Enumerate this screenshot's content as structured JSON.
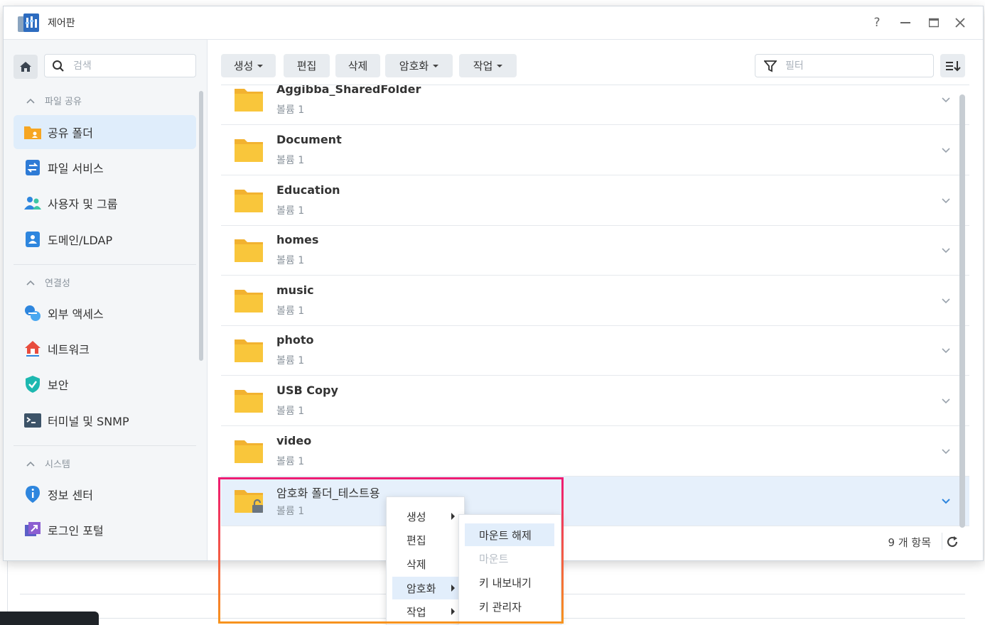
{
  "window": {
    "title": "제어판"
  },
  "titlebar": {
    "help": "?",
    "minimize": "—",
    "maximize": "▭",
    "close": "✕"
  },
  "sidebar": {
    "search_placeholder": "검색",
    "sections": [
      {
        "label": "파일 공유",
        "items": [
          {
            "label": "공유 폴더",
            "icon": "shared-folder-icon",
            "active": true
          },
          {
            "label": "파일 서비스",
            "icon": "file-services-icon"
          },
          {
            "label": "사용자 및 그룹",
            "icon": "user-group-icon"
          },
          {
            "label": "도메인/LDAP",
            "icon": "domain-ldap-icon"
          }
        ]
      },
      {
        "label": "연결성",
        "items": [
          {
            "label": "외부 액세스",
            "icon": "external-access-icon"
          },
          {
            "label": "네트워크",
            "icon": "network-icon"
          },
          {
            "label": "보안",
            "icon": "security-icon"
          },
          {
            "label": "터미널 및 SNMP",
            "icon": "terminal-icon"
          }
        ]
      },
      {
        "label": "시스템",
        "items": [
          {
            "label": "정보 센터",
            "icon": "info-center-icon"
          },
          {
            "label": "로그인 포털",
            "icon": "login-portal-icon"
          }
        ]
      }
    ]
  },
  "toolbar": {
    "create": "생성",
    "edit": "편집",
    "delete": "삭제",
    "encryption": "암호화",
    "action": "작업",
    "filter_placeholder": "필터"
  },
  "folders": [
    {
      "name": "Aggibba_SharedFolder",
      "volume": "볼륨 1"
    },
    {
      "name": "Document",
      "volume": "볼륨 1"
    },
    {
      "name": "Education",
      "volume": "볼륨 1"
    },
    {
      "name": "homes",
      "volume": "볼륨 1"
    },
    {
      "name": "music",
      "volume": "볼륨 1"
    },
    {
      "name": "photo",
      "volume": "볼륨 1"
    },
    {
      "name": "USB Copy",
      "volume": "볼륨 1"
    },
    {
      "name": "video",
      "volume": "볼륨 1"
    },
    {
      "name": "암호화 폴더_테스트용",
      "volume": "볼륨 1",
      "encrypted": true,
      "selected": true
    }
  ],
  "footer": {
    "item_count": "9 개 항목"
  },
  "context_menu": {
    "items": [
      "생성",
      "편집",
      "삭제",
      "암호화",
      "작업"
    ],
    "highlighted": "암호화"
  },
  "encryption_submenu": {
    "items": [
      {
        "label": "마운트 해제",
        "state": "highlighted"
      },
      {
        "label": "마운트",
        "state": "disabled"
      },
      {
        "label": "키 내보내기",
        "state": "normal"
      },
      {
        "label": "키 관리자",
        "state": "normal"
      }
    ]
  },
  "colors": {
    "accent": "#2e86de",
    "selected_row": "#e6f0fb",
    "folder": "#f9c63b",
    "annotation_top": "#ee1b72",
    "annotation_bottom": "#f7931e"
  }
}
